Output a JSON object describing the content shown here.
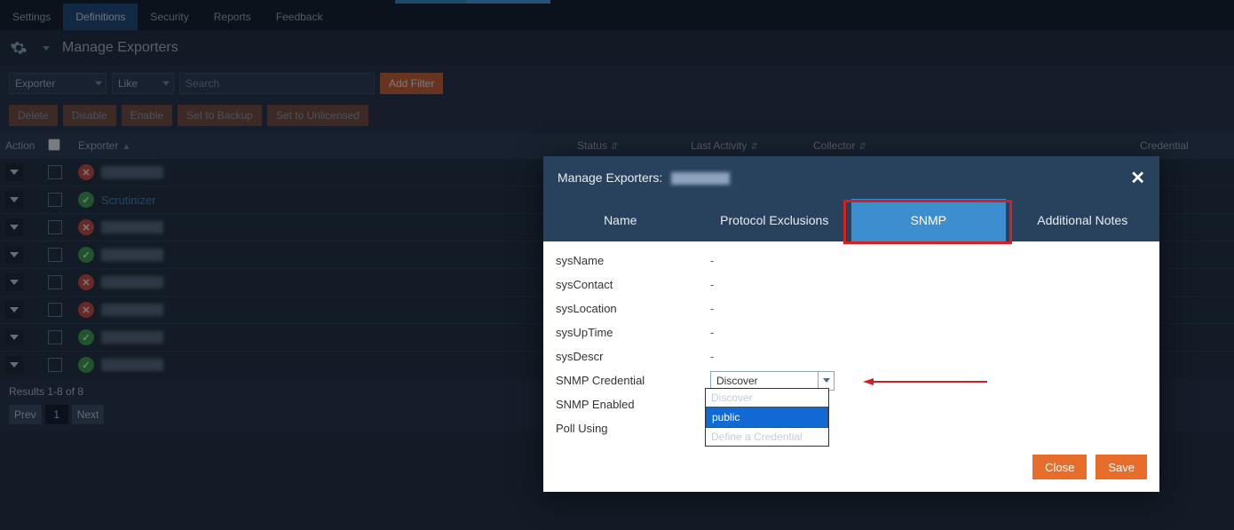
{
  "nav": {
    "tabs": [
      "Settings",
      "Definitions",
      "Security",
      "Reports",
      "Feedback"
    ],
    "active": "Definitions"
  },
  "page": {
    "title": "Manage Exporters"
  },
  "filter": {
    "field": "Exporter",
    "op": "Like",
    "search_placeholder": "Search",
    "add_filter": "Add Filter"
  },
  "action_buttons": [
    "Delete",
    "Disable",
    "Enable",
    "Set to Backup",
    "Set to Unlicensed"
  ],
  "columns": {
    "action": "Action",
    "exporter": "Exporter",
    "status": "Status",
    "last_activity": "Last Activity",
    "collector": "Collector",
    "credential": "Credential"
  },
  "rows": [
    {
      "status": "bad",
      "label": "",
      "blurred": true
    },
    {
      "status": "ok",
      "label": "Scrutinizer",
      "blurred": false
    },
    {
      "status": "bad",
      "label": "",
      "blurred": true
    },
    {
      "status": "ok",
      "label": "",
      "blurred": true
    },
    {
      "status": "bad",
      "label": "",
      "blurred": true
    },
    {
      "status": "bad",
      "label": "",
      "blurred": true
    },
    {
      "status": "ok",
      "label": "",
      "blurred": true
    },
    {
      "status": "ok",
      "label": "",
      "blurred": true
    }
  ],
  "results_text": "Results 1-8 of 8",
  "pager": {
    "prev": "Prev",
    "page": "1",
    "next": "Next"
  },
  "modal": {
    "title_prefix": "Manage Exporters: ",
    "tabs": {
      "name": "Name",
      "proto": "Protocol Exclusions",
      "snmp": "SNMP",
      "notes": "Additional Notes"
    },
    "fields": {
      "sysName": {
        "label": "sysName",
        "value": "-"
      },
      "sysContact": {
        "label": "sysContact",
        "value": "-"
      },
      "sysLocation": {
        "label": "sysLocation",
        "value": "-"
      },
      "sysUpTime": {
        "label": "sysUpTime",
        "value": "-"
      },
      "sysDescr": {
        "label": "sysDescr",
        "value": "-"
      },
      "snmpCred": {
        "label": "SNMP Credential",
        "value": "Discover"
      },
      "snmpEnabled": {
        "label": "SNMP Enabled",
        "value": ""
      },
      "pollUsing": {
        "label": "Poll Using",
        "value": ""
      }
    },
    "dropdown_options": [
      "Discover",
      "public",
      "Define a Credential"
    ],
    "dropdown_selected": "public",
    "close": "Close",
    "save": "Save"
  }
}
